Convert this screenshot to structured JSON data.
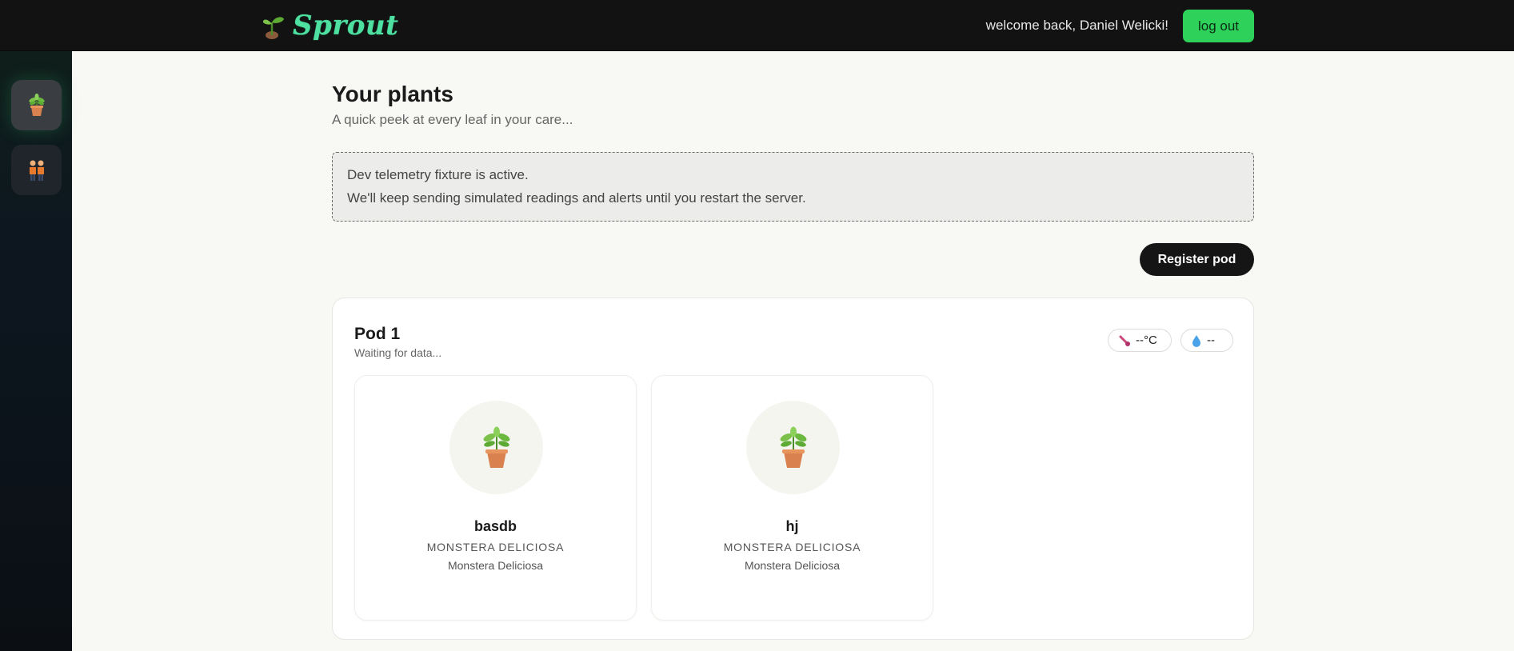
{
  "header": {
    "brand": "Sprout",
    "welcome": "welcome back, Daniel Welicki!",
    "logout_label": "log out"
  },
  "sidebar": {
    "items": [
      {
        "icon": "potted-plant-icon",
        "active": true
      },
      {
        "icon": "people-icon",
        "active": false
      }
    ]
  },
  "main": {
    "title": "Your plants",
    "subtitle": "A quick peek at every leaf in your care...",
    "notice": {
      "line1": "Dev telemetry fixture is active.",
      "line2": "We'll keep sending simulated readings and alerts until you restart the server."
    },
    "register_label": "Register pod",
    "pods": [
      {
        "name": "Pod 1",
        "status": "Waiting for data...",
        "temperature": "--°C",
        "moisture": "--",
        "plants": [
          {
            "name": "basdb",
            "species": "MONSTERA DELICIOSA",
            "common": "Monstera Deliciosa"
          },
          {
            "name": "hj",
            "species": "MONSTERA DELICIOSA",
            "common": "Monstera Deliciosa"
          }
        ]
      }
    ]
  },
  "colors": {
    "accent": "#2ed15a",
    "brand": "#4ee0a0",
    "topbar": "#121212"
  }
}
